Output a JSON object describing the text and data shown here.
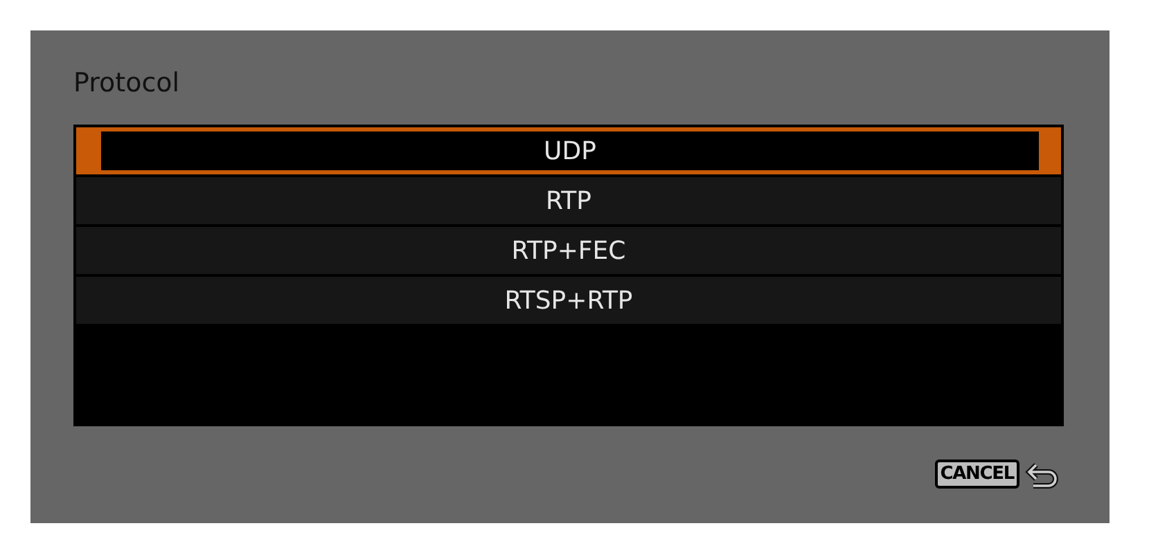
{
  "dialog": {
    "title": "Protocol"
  },
  "options": [
    {
      "label": "UDP",
      "selected": true
    },
    {
      "label": "RTP",
      "selected": false
    },
    {
      "label": "RTP+FEC",
      "selected": false
    },
    {
      "label": "RTSP+RTP",
      "selected": false
    }
  ],
  "cancel": {
    "label": "CANCEL"
  }
}
